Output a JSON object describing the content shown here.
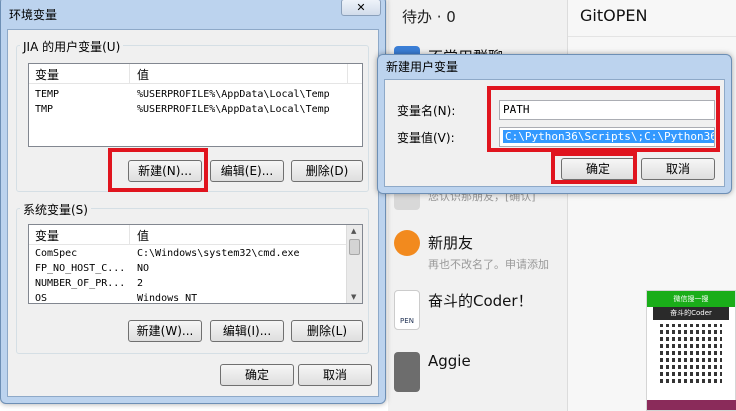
{
  "env_dialog": {
    "title": "环境变量",
    "user_group_label": "JIA 的用户变量(U)",
    "user_headers": [
      "变量",
      "值"
    ],
    "user_rows": [
      {
        "name": "TEMP",
        "value": "%USERPROFILE%\\AppData\\Local\\Temp"
      },
      {
        "name": "TMP",
        "value": "%USERPROFILE%\\AppData\\Local\\Temp"
      }
    ],
    "user_buttons": {
      "new": "新建(N)...",
      "edit": "编辑(E)...",
      "delete": "删除(D)"
    },
    "system_group_label": "系统变量(S)",
    "system_headers": [
      "变量",
      "值"
    ],
    "system_rows": [
      {
        "name": "ComSpec",
        "value": "C:\\Windows\\system32\\cmd.exe"
      },
      {
        "name": "FP_NO_HOST_C...",
        "value": "NO"
      },
      {
        "name": "NUMBER_OF_PR...",
        "value": "2"
      },
      {
        "name": "OS",
        "value": "Windows_NT"
      }
    ],
    "system_buttons": {
      "new": "新建(W)...",
      "edit": "编辑(I)...",
      "delete": "删除(L)"
    },
    "ok": "确定",
    "cancel": "取消"
  },
  "new_var_dialog": {
    "title": "新建用户变量",
    "name_label": "变量名(N):",
    "name_value": "PATH",
    "value_label": "变量值(V):",
    "value_value": "C:\\Python36\\Scripts\\;C:\\Python36\\",
    "ok": "确定",
    "cancel": "取消"
  },
  "chat_list": {
    "header": "待办 · 0",
    "items": [
      {
        "title": "不常用群聊",
        "subtitle": ""
      },
      {
        "title": "",
        "subtitle": "您认识那朋友，[确认]"
      },
      {
        "title": "新朋友",
        "subtitle": "再也不改名了。申请添加"
      },
      {
        "title": "奋斗的Coder！",
        "subtitle": ""
      },
      {
        "title": "Aggie",
        "subtitle": ""
      }
    ]
  },
  "chat_panel": {
    "title": "GitOPEN"
  },
  "qr_card": {
    "top_text": "微信搜一搜",
    "name": "奋斗的Coder"
  },
  "avatar_text": "PEN",
  "colors": {
    "highlight_red": "#e0141e",
    "selection_blue": "#3399ff",
    "wechat_green": "#1aad19",
    "window_frame": "#bcd3ee"
  }
}
